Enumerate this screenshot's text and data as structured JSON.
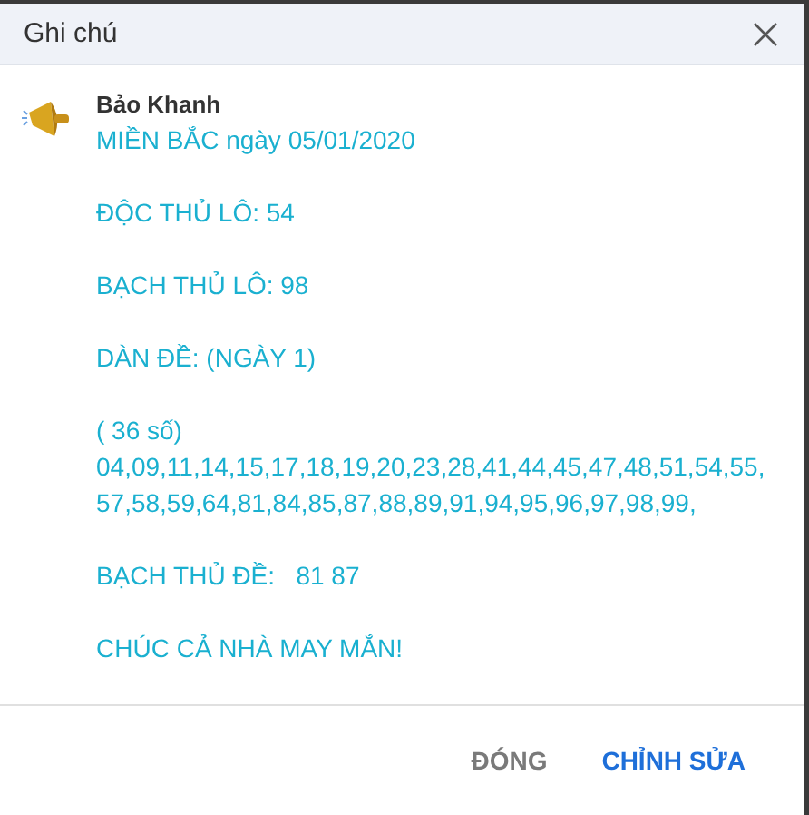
{
  "window": {
    "title": "Ghi chú"
  },
  "note": {
    "author": "Bảo Khanh",
    "paragraphs": [
      [
        "MIỀN BẮC ngày 05/01/2020"
      ],
      [
        "ĐỘC THỦ LÔ: 54"
      ],
      [
        "BẠCH THỦ LÔ: 98"
      ],
      [
        "DÀN ĐỀ: (NGÀY 1)"
      ],
      [
        "( 36 số)",
        "04,09,11,14,15,17,18,19,20,23,28,41,44,45,47,48,51,54,55,",
        "57,58,59,64,81,84,85,87,88,89,91,94,95,96,97,98,99,"
      ],
      [
        "BẠCH THỦ ĐỀ:   81 87"
      ],
      [
        "CHÚC CẢ NHÀ MAY MẮN!"
      ]
    ]
  },
  "buttons": [
    {
      "label": "ĐÓNG",
      "kind": "secondary"
    },
    {
      "label": "CHỈNH SỬA",
      "kind": "primary"
    }
  ]
}
